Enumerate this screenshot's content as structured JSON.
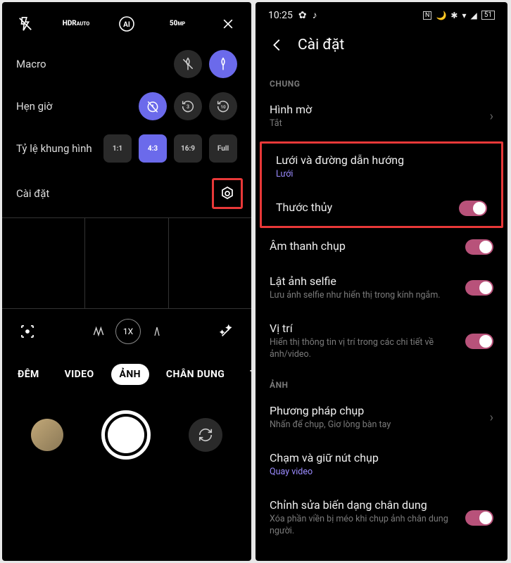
{
  "left": {
    "top_icons": [
      "flash-off",
      "hdr-auto",
      "ai",
      "50mp",
      "close"
    ],
    "options": {
      "macro": {
        "label": "Macro"
      },
      "timer": {
        "label": "Hẹn giờ",
        "vals": [
          "off",
          "3",
          "10"
        ]
      },
      "aspect": {
        "label": "Tỷ lệ khung hình",
        "vals": [
          "1:1",
          "4:3",
          "16:9",
          "Full"
        ]
      },
      "settings": {
        "label": "Cài đặt"
      }
    },
    "zoom": {
      "wide": "wide",
      "value": "1X",
      "tele": "tele"
    },
    "modes": [
      "ĐÊM",
      "VIDEO",
      "ẢNH",
      "CHÂN DUNG",
      "T"
    ],
    "active_mode_index": 2
  },
  "right": {
    "status": {
      "time": "10:25",
      "battery": "51"
    },
    "header": "Cài đặt",
    "section_general": "CHUNG",
    "section_photo": "ẢNH",
    "items": {
      "watermark": {
        "title": "Hình mờ",
        "sub": "Tắt"
      },
      "grid": {
        "title": "Lưới và đường dẫn hướng",
        "sub": "Lưới"
      },
      "level": {
        "title": "Thước thủy"
      },
      "shutter_sound": {
        "title": "Âm thanh chụp"
      },
      "mirror": {
        "title": "Lật ảnh selfie",
        "sub": "Lưu ảnh selfie như hiển thị trong kính ngắm."
      },
      "location": {
        "title": "Vị trí",
        "sub": "Hiển thị thông tin vị trí trong các chi tiết về ảnh/video."
      },
      "capture": {
        "title": "Phương pháp chụp",
        "sub": "Nhấn để chụp, Giơ lòng bàn tay"
      },
      "hold": {
        "title": "Chạm và giữ nút chụp",
        "sub": "Quay video"
      },
      "distort": {
        "title": "Chỉnh sửa biến dạng chân dung",
        "sub": "Xóa phần viền bị méo khi chụp ảnh chân dung người."
      }
    }
  }
}
